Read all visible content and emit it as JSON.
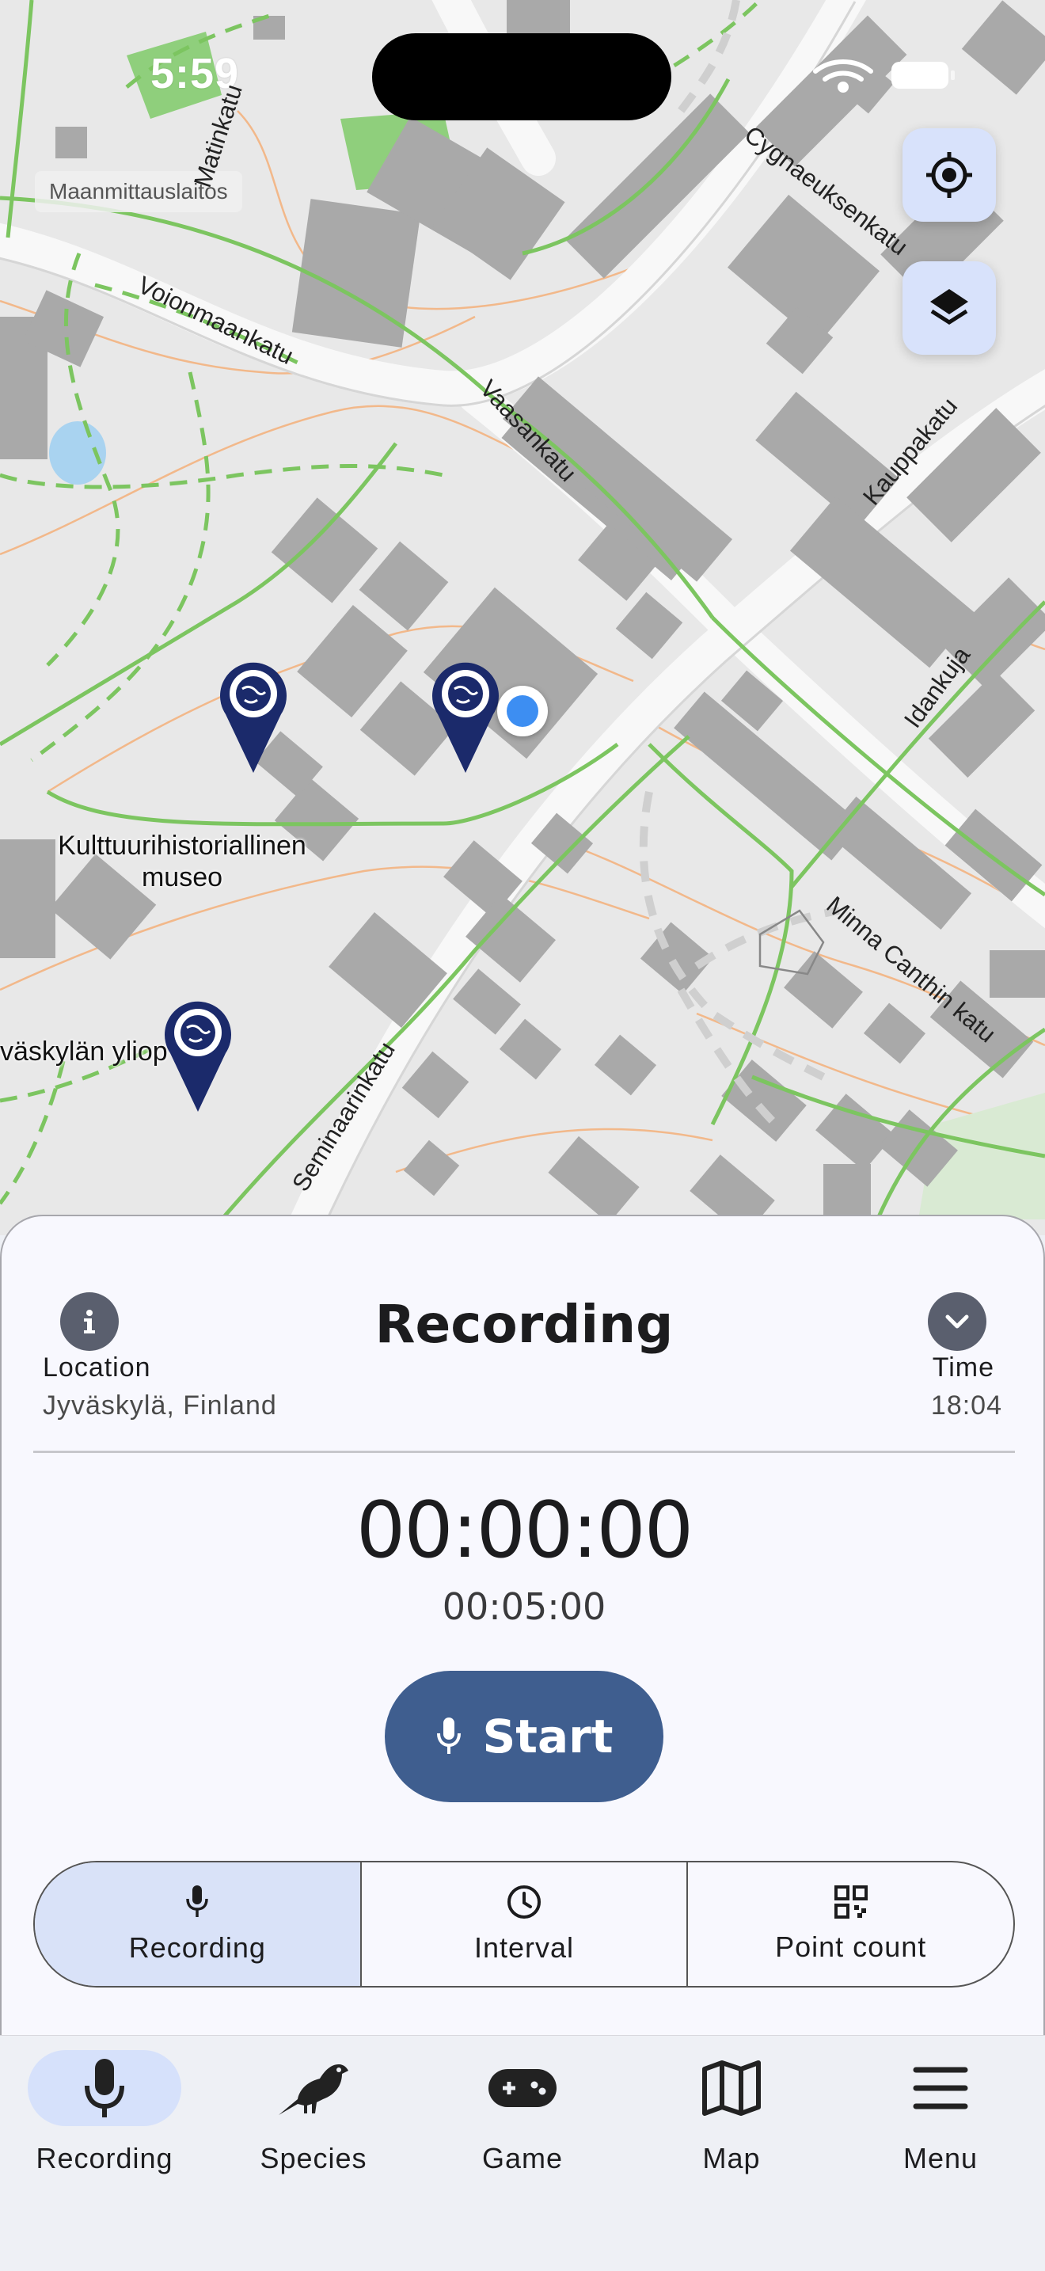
{
  "status_bar": {
    "time": "5:59"
  },
  "map": {
    "attribution": "Maanmittauslaitos",
    "street_labels": [
      "Cygnaeuksenkatu",
      "Voionmaankatu",
      "Vaasankatu",
      "Kauppakatu",
      "Idankuja",
      "Minna Canthin katu",
      "Seminaarinkatu",
      "Matinkatu"
    ],
    "poi_labels": {
      "museum_line1": "Kulttuurihistoriallinen",
      "museum_line2": "museo",
      "university": "väskylän yliop"
    },
    "buttons": {
      "locate": "crosshairs-icon",
      "layers": "layers-icon"
    }
  },
  "sheet": {
    "title": "Recording",
    "location_label": "Location",
    "location_value": "Jyväskylä, Finland",
    "time_label": "Time",
    "time_value": "18:04",
    "timer": "00:00:00",
    "duration": "00:05:00",
    "start_label": "Start",
    "modes": [
      {
        "label": "Recording",
        "icon": "microphone-icon",
        "active": true
      },
      {
        "label": "Interval",
        "icon": "clock-icon",
        "active": false
      },
      {
        "label": "Point count",
        "icon": "qr-code-icon",
        "active": false
      }
    ]
  },
  "tabs": [
    {
      "label": "Recording",
      "icon": "microphone-icon",
      "active": true
    },
    {
      "label": "Species",
      "icon": "bird-icon",
      "active": false
    },
    {
      "label": "Game",
      "icon": "gamepad-icon",
      "active": false
    },
    {
      "label": "Map",
      "icon": "map-icon",
      "active": false
    },
    {
      "label": "Menu",
      "icon": "menu-icon",
      "active": false
    }
  ],
  "colors": {
    "accent": "#3f5e8f",
    "active_tint": "#d9e2f8",
    "map_button": "#d8e2fb",
    "pin": "#1b2a6b",
    "user_location": "#3d8ef2"
  }
}
